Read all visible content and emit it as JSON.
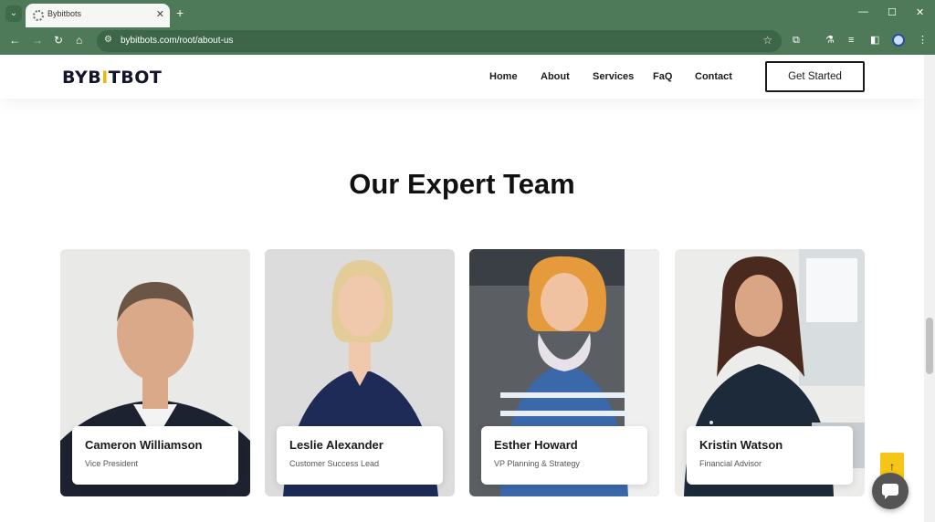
{
  "browser": {
    "tab_title": "Bybitbots",
    "url": "bybitbots.com/root/about-us",
    "icons": [
      "tab-list-icon",
      "close-icon",
      "new-tab-icon",
      "minimize-icon",
      "maximize-icon",
      "window-close-icon",
      "back-icon",
      "forward-icon",
      "reload-icon",
      "home-icon",
      "site-info-icon",
      "star-icon",
      "extensions-icon",
      "labs-icon",
      "reading-list-icon",
      "side-panel-icon",
      "profile-icon",
      "menu-icon"
    ],
    "glyphs": {
      "tab_list": "⌄",
      "tab_close": "✕",
      "new_tab": "+",
      "minimize": "—",
      "maximize": "☐",
      "close": "✕",
      "back": "←",
      "forward": "→",
      "reload": "↻",
      "home": "⌂",
      "site_info": "⚙",
      "star": "☆",
      "extensions": "⧉",
      "labs": "⚗",
      "reading": "≡",
      "side_panel": "◧",
      "menu": "⋮"
    }
  },
  "site": {
    "logo_left": "BYB",
    "logo_accent": "I",
    "logo_right": "TBOT",
    "nav": [
      "Home",
      "About",
      "Services",
      "FaQ",
      "Contact"
    ],
    "cta_label": "Get Started"
  },
  "section": {
    "title": "Our Expert Team"
  },
  "team": [
    {
      "name": "Cameron Williamson",
      "role": "Vice President"
    },
    {
      "name": "Leslie Alexander",
      "role": "Customer Success Lead"
    },
    {
      "name": "Esther Howard",
      "role": "VP Planning & Strategy"
    },
    {
      "name": "Kristin Watson",
      "role": "Financial Advisor"
    }
  ],
  "floating": {
    "to_top_glyph": "↑"
  },
  "colors": {
    "browser_frame": "#4f7a5a",
    "brand_accent": "#f2b705",
    "to_top": "#f5c518"
  }
}
